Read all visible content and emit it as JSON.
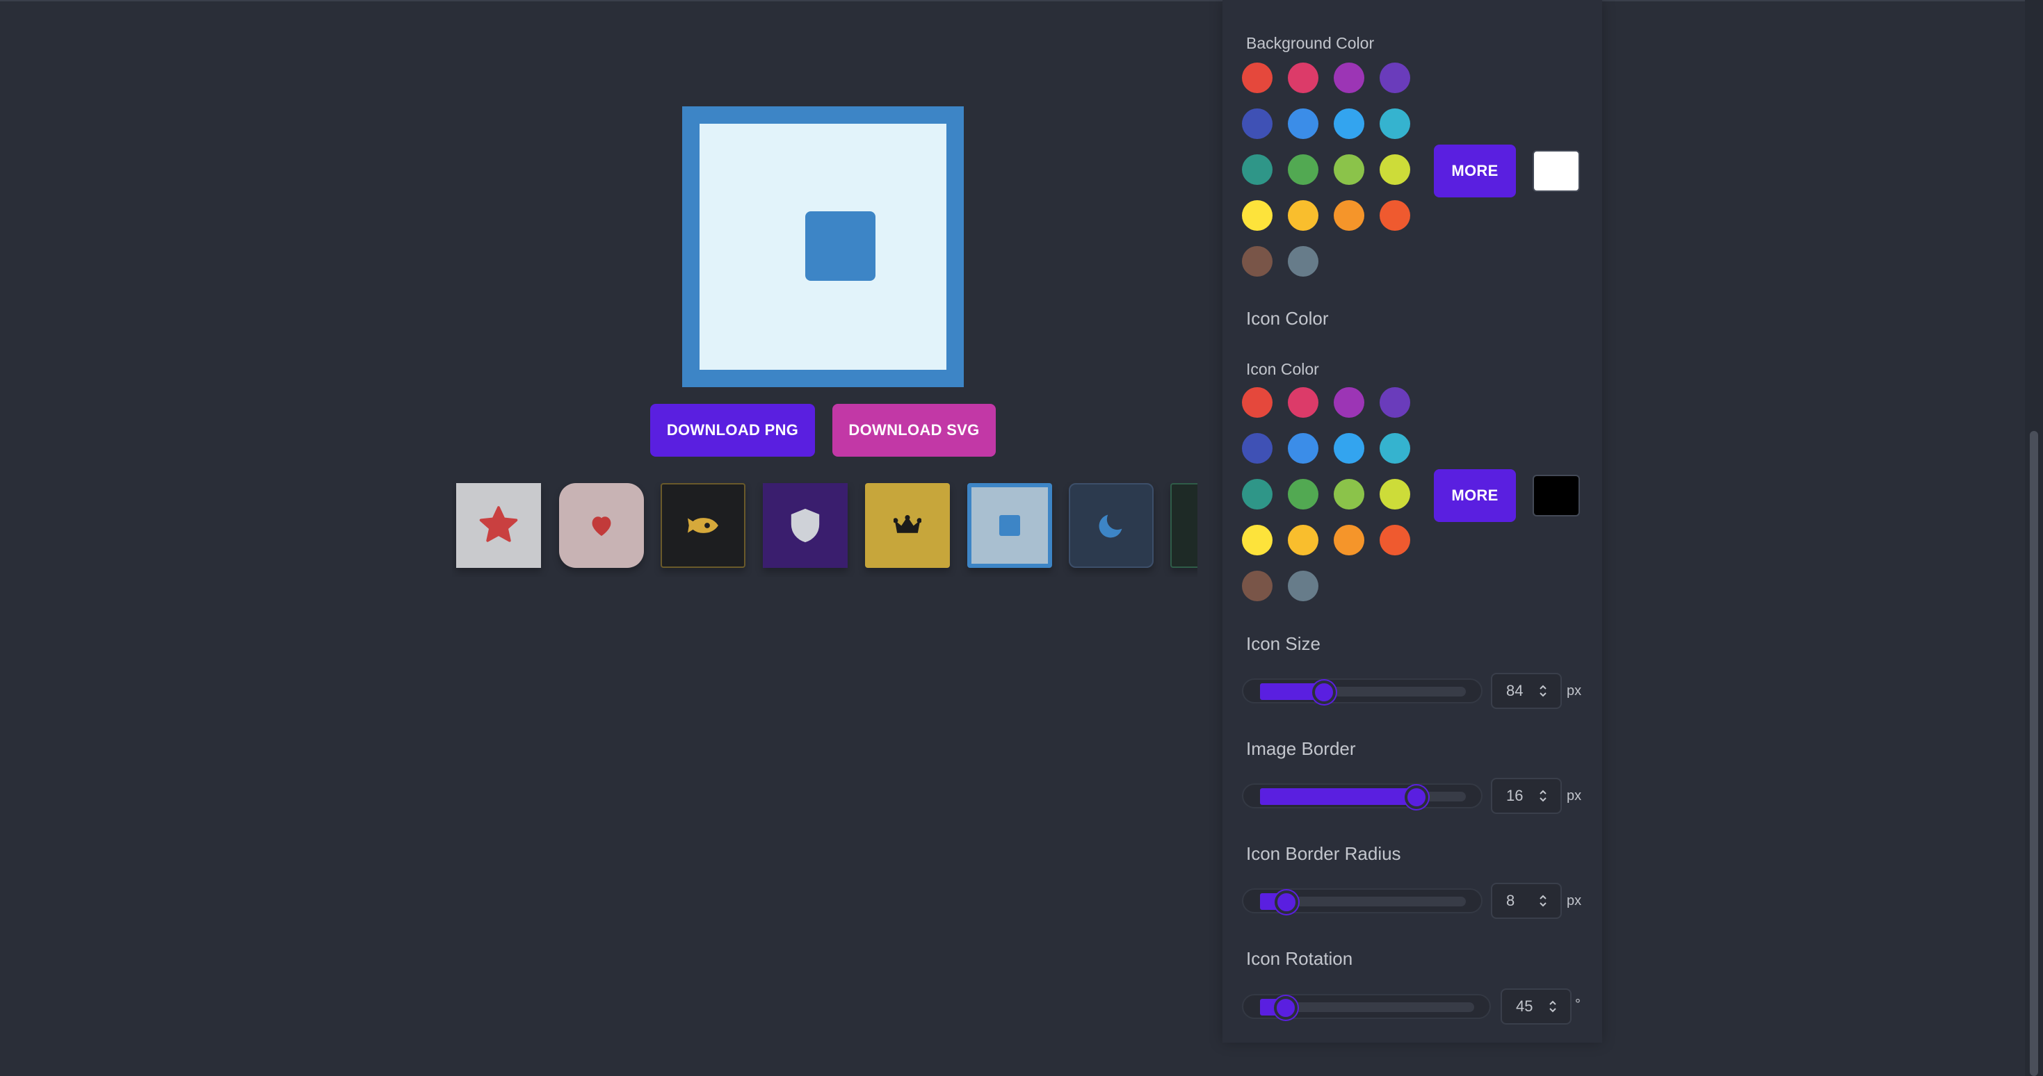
{
  "preview": {
    "border_color": "#3d85c6",
    "background_color": "#e2f3fa",
    "icon_color": "#3d85c6",
    "icon": "square-icon"
  },
  "buttons": {
    "download_png": "DOWNLOAD PNG",
    "download_svg": "DOWNLOAD SVG"
  },
  "presets": [
    {
      "icon": "star-icon",
      "bg": "#c9cacd",
      "color": "#c94040"
    },
    {
      "icon": "heart-icon",
      "bg": "#c8b3b4",
      "color": "#c23a3a"
    },
    {
      "icon": "rocket-icon",
      "bg": "#1d1e20",
      "color": "#d6a93b"
    },
    {
      "icon": "shield-icon",
      "bg": "#3a1e6e",
      "color": "#cfd2d8"
    },
    {
      "icon": "crown-icon",
      "bg": "#c7a63b",
      "color": "#1b1b1b"
    },
    {
      "icon": "square-icon",
      "bg": "#a9bfd0",
      "color": "#3d85c6"
    },
    {
      "icon": "moon-icon",
      "bg": "#2c3a4e",
      "color": "#3d85c6"
    }
  ],
  "background_section": {
    "label": "Background Color",
    "more_label": "MORE",
    "selected_color": "#ffffff"
  },
  "icon_color_section": {
    "heading": "Icon Color",
    "label": "Icon Color",
    "more_label": "MORE",
    "selected_color": "#000000"
  },
  "palette": [
    "#e5483c",
    "#dc3b69",
    "#9c35b5",
    "#6a3cbb",
    "#3f51b5",
    "#3b8de8",
    "#33a4ef",
    "#35b3cf",
    "#2f9688",
    "#52a952",
    "#8bc34a",
    "#cddc39",
    "#fde33b",
    "#f9be2d",
    "#f5952a",
    "#ef5a2f",
    "#795548",
    "#677c8a"
  ],
  "sliders": {
    "icon_size": {
      "label": "Icon Size",
      "value": "84",
      "unit": "px",
      "fraction": 0.31
    },
    "image_border": {
      "label": "Image Border",
      "value": "16",
      "unit": "px",
      "fraction": 0.76
    },
    "icon_border_radius": {
      "label": "Icon Border Radius",
      "value": "8",
      "unit": "px",
      "fraction": 0.13
    },
    "icon_rotation": {
      "label": "Icon Rotation",
      "value": "45",
      "unit": "°",
      "fraction": 0.12
    }
  }
}
